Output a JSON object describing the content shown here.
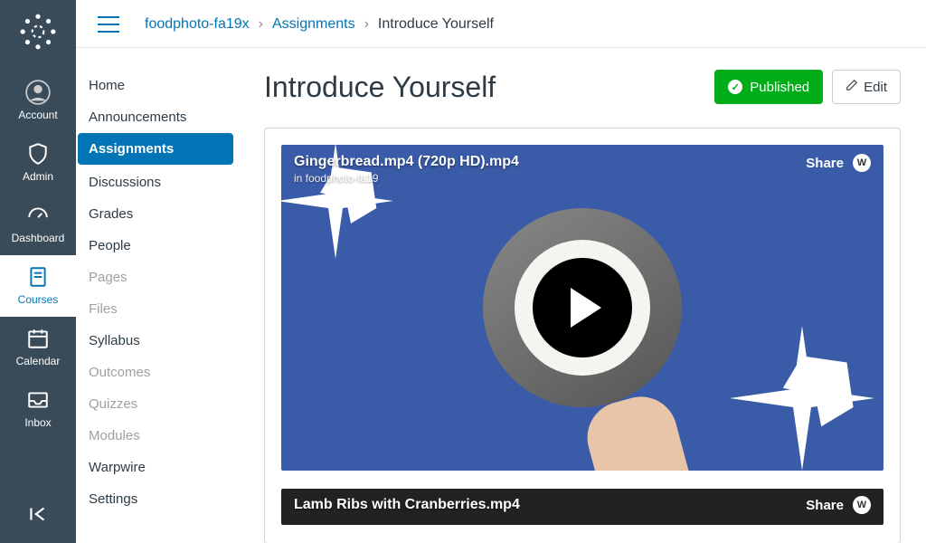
{
  "global_nav": {
    "items": [
      {
        "label": "Account"
      },
      {
        "label": "Admin"
      },
      {
        "label": "Dashboard"
      },
      {
        "label": "Courses"
      },
      {
        "label": "Calendar"
      },
      {
        "label": "Inbox"
      }
    ]
  },
  "breadcrumb": {
    "course": "foodphoto-fa19x",
    "section": "Assignments",
    "current": "Introduce Yourself"
  },
  "course_nav": {
    "items": [
      {
        "label": "Home",
        "state": "normal"
      },
      {
        "label": "Announcements",
        "state": "normal"
      },
      {
        "label": "Assignments",
        "state": "active"
      },
      {
        "label": "Discussions",
        "state": "normal"
      },
      {
        "label": "Grades",
        "state": "normal"
      },
      {
        "label": "People",
        "state": "normal"
      },
      {
        "label": "Pages",
        "state": "disabled"
      },
      {
        "label": "Files",
        "state": "disabled"
      },
      {
        "label": "Syllabus",
        "state": "normal"
      },
      {
        "label": "Outcomes",
        "state": "disabled"
      },
      {
        "label": "Quizzes",
        "state": "disabled"
      },
      {
        "label": "Modules",
        "state": "disabled"
      },
      {
        "label": "Warpwire",
        "state": "normal"
      },
      {
        "label": "Settings",
        "state": "normal"
      }
    ]
  },
  "page": {
    "title": "Introduce Yourself",
    "published_label": "Published",
    "edit_label": "Edit"
  },
  "videos": [
    {
      "title": "Gingerbread.mp4 (720p HD).mp4",
      "subtitle": "in foodphoto-fa19",
      "share_label": "Share",
      "badge": "W"
    },
    {
      "title": "Lamb Ribs with Cranberries.mp4",
      "share_label": "Share",
      "badge": "W"
    }
  ],
  "colors": {
    "nav_bg": "#394B58",
    "link": "#0374B5",
    "published": "#00AC18",
    "video_bg": "#3A5BA8"
  }
}
